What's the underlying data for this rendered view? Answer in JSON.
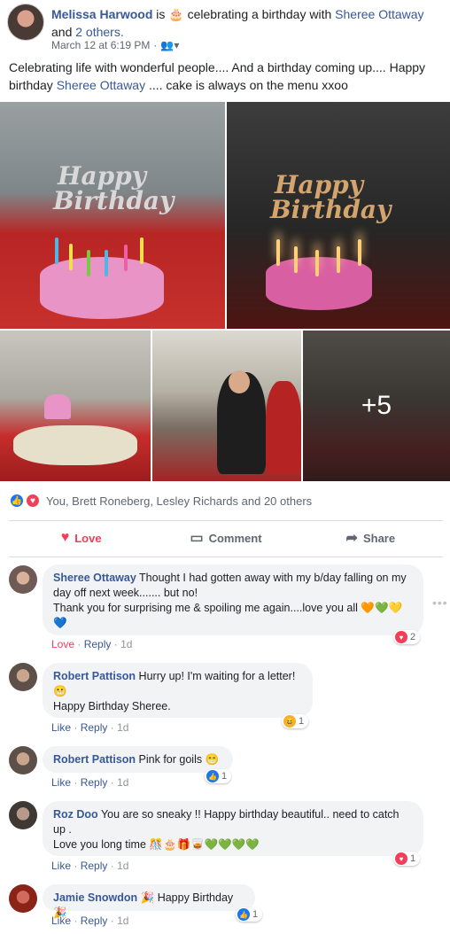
{
  "post": {
    "author": "Melissa Harwood",
    "is_text": "is",
    "activity_text": "celebrating a birthday with",
    "tagged": "Sheree Ottaway",
    "and_text": "and",
    "others": "2 others.",
    "timestamp": "March 12 at 6:19 PM",
    "audience_icon": "friends-icon",
    "body_part1": "Celebrating life with wonderful people.... And a birthday coming up.... Happy birthday",
    "body_mention": "Sheree Ottaway",
    "body_part2": ".... cake is always on the menu xxoo",
    "photos": {
      "topper_text": "Happy Birthday",
      "more_count": "+5"
    }
  },
  "reactions": {
    "summary": "You, Brett Roneberg, Lesley Richards and 20 others"
  },
  "actions": {
    "love": "Love",
    "comment": "Comment",
    "share": "Share"
  },
  "comments": [
    {
      "author": "Sheree Ottaway",
      "text1": "Thought I had gotten away with my b/day falling on my day off next week....... but no!",
      "text2": "Thank you for surprising me & spoiling me again....love you all",
      "emoji": "🧡💚💛💙",
      "action": "Love",
      "reply": "Reply",
      "time": "1d",
      "reaction_count": "2"
    },
    {
      "author": "Robert Pattison",
      "text1": "Hurry up! I'm waiting for a letter!",
      "emoji": "😬",
      "text2": "Happy Birthday Sheree.",
      "action": "Like",
      "reply": "Reply",
      "time": "1d",
      "reaction_count": "1"
    },
    {
      "author": "Robert Pattison",
      "text1": "Pink for goils",
      "emoji": "😁",
      "action": "Like",
      "reply": "Reply",
      "time": "1d",
      "reaction_count": "1"
    },
    {
      "author": "Roz Doo",
      "text1": "You are so sneaky !! Happy birthday beautiful.. need to catch up .",
      "text2": "Love you long time",
      "emoji": "🎊🎂🎁🥃💚💚💚💚",
      "action": "Like",
      "reply": "Reply",
      "time": "1d",
      "reaction_count": "1"
    },
    {
      "author": "Jamie Snowdon",
      "text1": "Happy Birthday",
      "emoji": "🎉",
      "action": "Like",
      "reply": "Reply",
      "time": "1d",
      "reaction_count": "1"
    }
  ],
  "colors": {
    "link": "#385898",
    "love": "#f33e58",
    "like": "#1877f2",
    "bubble": "#f2f3f5"
  }
}
